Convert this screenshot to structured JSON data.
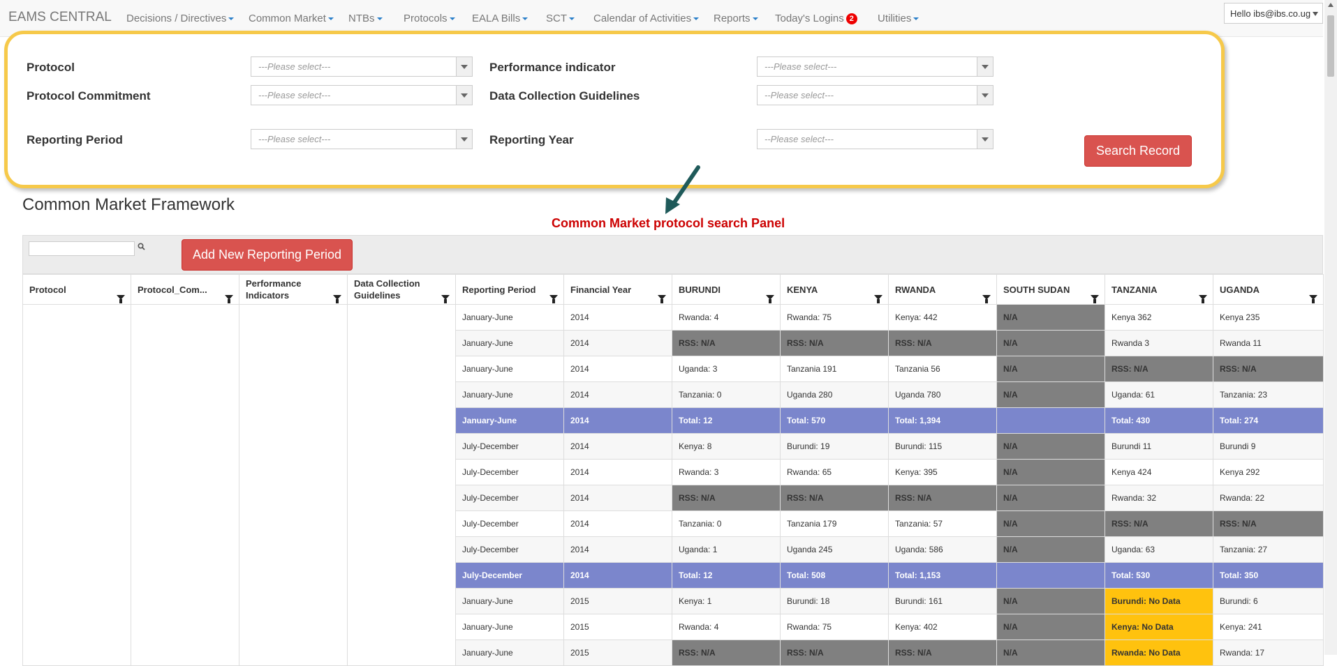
{
  "nav": {
    "brand": "EAMS CENTRAL",
    "items": [
      {
        "label": "Decisions / Directives"
      },
      {
        "label": "Common Market"
      },
      {
        "label": "NTBs"
      },
      {
        "label": "Protocols"
      },
      {
        "label": "EALA Bills"
      },
      {
        "label": "SCT"
      },
      {
        "label": "Calendar of Activities"
      },
      {
        "label": "Reports"
      },
      {
        "label": "Today's Logins",
        "badge": "2"
      },
      {
        "label": "Utilities"
      }
    ],
    "user": "Hello ibs@ibs.co.ug"
  },
  "search_panel": {
    "fields": [
      {
        "label": "Protocol",
        "placeholder": "---Please select---"
      },
      {
        "label": "Performance indicator",
        "placeholder": "---Please select---"
      },
      {
        "label": "Protocol Commitment",
        "placeholder": "---Please select---"
      },
      {
        "label": "Data Collection Guidelines",
        "placeholder": "--Please select---"
      },
      {
        "label": "Reporting Period",
        "placeholder": "---Please select---"
      },
      {
        "label": "Reporting Year",
        "placeholder": "--Please select---"
      }
    ],
    "search_button": "Search Record"
  },
  "page_title": "Common Market Framework",
  "annotation": "Common Market protocol search Panel",
  "grid": {
    "add_button": "Add New Reporting Period",
    "search_icon": "magnifier-icon",
    "columns": [
      "Protocol",
      "Protocol_Com...",
      "Performance Indicators",
      "Data Collection Guidelines",
      "Reporting Period",
      "Financial Year",
      "BURUNDI",
      "KENYA",
      "RWANDA",
      "SOUTH SUDAN",
      "TANZANIA",
      "UGANDA"
    ],
    "rows": [
      {
        "type": "normal",
        "cells": [
          "January-June",
          "2014",
          "Rwanda: 4",
          "Rwanda: 75",
          "Kenya: 442",
          "N/A",
          "Kenya 362",
          "Kenya 235"
        ],
        "na": [
          5
        ],
        "nodata": []
      },
      {
        "type": "normal",
        "cells": [
          "January-June",
          "2014",
          "RSS: N/A",
          "RSS: N/A",
          "RSS: N/A",
          "N/A",
          "Rwanda 3",
          "Rwanda 11"
        ],
        "na": [
          2,
          3,
          4,
          5
        ],
        "nodata": []
      },
      {
        "type": "normal",
        "cells": [
          "January-June",
          "2014",
          "Uganda: 3",
          "Tanzania 191",
          "Tanzania 56",
          "N/A",
          "RSS: N/A",
          "RSS: N/A"
        ],
        "na": [
          5,
          6,
          7
        ],
        "nodata": []
      },
      {
        "type": "normal",
        "cells": [
          "January-June",
          "2014",
          "Tanzania: 0",
          "Uganda 280",
          "Uganda 780",
          "N/A",
          "Uganda: 61",
          "Tanzania: 23"
        ],
        "na": [
          5
        ],
        "nodata": []
      },
      {
        "type": "total",
        "cells": [
          "January-June",
          "2014",
          "Total: 12",
          "Total: 570",
          "Total: 1,394",
          "",
          "Total: 430",
          "Total: 274"
        ],
        "na": [],
        "nodata": []
      },
      {
        "type": "normal",
        "cells": [
          "July-December",
          "2014",
          "Kenya: 8",
          "Burundi: 19",
          "Burundi: 115",
          "N/A",
          "Burundi 11",
          "Burundi 9"
        ],
        "na": [
          5
        ],
        "nodata": []
      },
      {
        "type": "normal",
        "cells": [
          "July-December",
          "2014",
          "Rwanda: 3",
          "Rwanda: 65",
          "Kenya: 395",
          "N/A",
          "Kenya 424",
          "Kenya 292"
        ],
        "na": [
          5
        ],
        "nodata": []
      },
      {
        "type": "normal",
        "cells": [
          "July-December",
          "2014",
          "RSS: N/A",
          "RSS: N/A",
          "RSS: N/A",
          "N/A",
          "Rwanda: 32",
          "Rwanda: 22"
        ],
        "na": [
          2,
          3,
          4,
          5
        ],
        "nodata": []
      },
      {
        "type": "normal",
        "cells": [
          "July-December",
          "2014",
          "Tanzania: 0",
          "Tanzania 179",
          "Tanzania: 57",
          "N/A",
          "RSS: N/A",
          "RSS: N/A"
        ],
        "na": [
          5,
          6,
          7
        ],
        "nodata": []
      },
      {
        "type": "normal",
        "cells": [
          "July-December",
          "2014",
          "Uganda: 1",
          "Uganda 245",
          "Uganda: 586",
          "N/A",
          "Uganda: 63",
          "Tanzania: 27"
        ],
        "na": [
          5
        ],
        "nodata": []
      },
      {
        "type": "total",
        "cells": [
          "July-December",
          "2014",
          "Total: 12",
          "Total: 508",
          "Total: 1,153",
          "",
          "Total: 530",
          "Total: 350"
        ],
        "na": [],
        "nodata": []
      },
      {
        "type": "normal",
        "cells": [
          "January-June",
          "2015",
          "Kenya: 1",
          "Burundi: 18",
          "Burundi: 161",
          "N/A",
          "Burundi: No Data",
          "Burundi: 6"
        ],
        "na": [
          5
        ],
        "nodata": [
          6
        ]
      },
      {
        "type": "normal",
        "cells": [
          "January-June",
          "2015",
          "Rwanda: 4",
          "Rwanda: 75",
          "Kenya: 402",
          "N/A",
          "Kenya: No Data",
          "Kenya: 241"
        ],
        "na": [
          5
        ],
        "nodata": [
          6
        ]
      },
      {
        "type": "normal",
        "cells": [
          "January-June",
          "2015",
          "RSS: N/A",
          "RSS: N/A",
          "RSS: N/A",
          "N/A",
          "Rwanda: No Data",
          "Rwanda: 17"
        ],
        "na": [
          2,
          3,
          4,
          5
        ],
        "nodata": [
          6
        ]
      }
    ]
  }
}
